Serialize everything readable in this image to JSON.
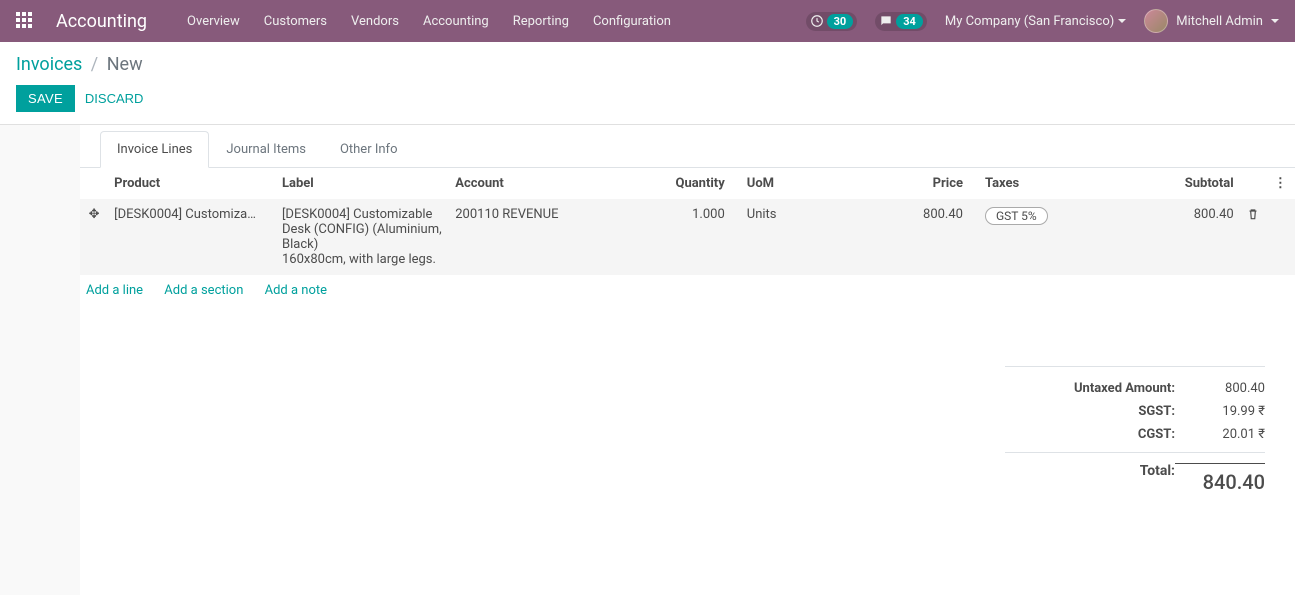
{
  "topbar": {
    "brand": "Accounting",
    "menu": [
      "Overview",
      "Customers",
      "Vendors",
      "Accounting",
      "Reporting",
      "Configuration"
    ],
    "clock_count": "30",
    "chat_count": "34",
    "company": "My Company (San Francisco)",
    "user": "Mitchell Admin"
  },
  "breadcrumb": {
    "parent": "Invoices",
    "current": "New"
  },
  "buttons": {
    "save": "Save",
    "discard": "Discard"
  },
  "tabs": [
    "Invoice Lines",
    "Journal Items",
    "Other Info"
  ],
  "columns": {
    "product": "Product",
    "label": "Label",
    "account": "Account",
    "quantity": "Quantity",
    "uom": "UoM",
    "price": "Price",
    "taxes": "Taxes",
    "subtotal": "Subtotal"
  },
  "lines": [
    {
      "product": "[DESK0004] Customiza…",
      "label": "[DESK0004] Customizable Desk (CONFIG) (Aluminium, Black)\n160x80cm, with large legs.",
      "account": "200110 REVENUE",
      "quantity": "1.000",
      "uom": "Units",
      "price": "800.40",
      "taxes": "GST 5%",
      "subtotal": "800.40"
    }
  ],
  "add_links": {
    "line": "Add a line",
    "section": "Add a section",
    "note": "Add a note"
  },
  "totals": {
    "untaxed_label": "Untaxed Amount:",
    "untaxed_value": "800.40",
    "sgst_label": "SGST:",
    "sgst_value": "19.99 ₹",
    "cgst_label": "CGST:",
    "cgst_value": "20.01 ₹",
    "total_label": "Total:",
    "total_value": "840.40"
  }
}
